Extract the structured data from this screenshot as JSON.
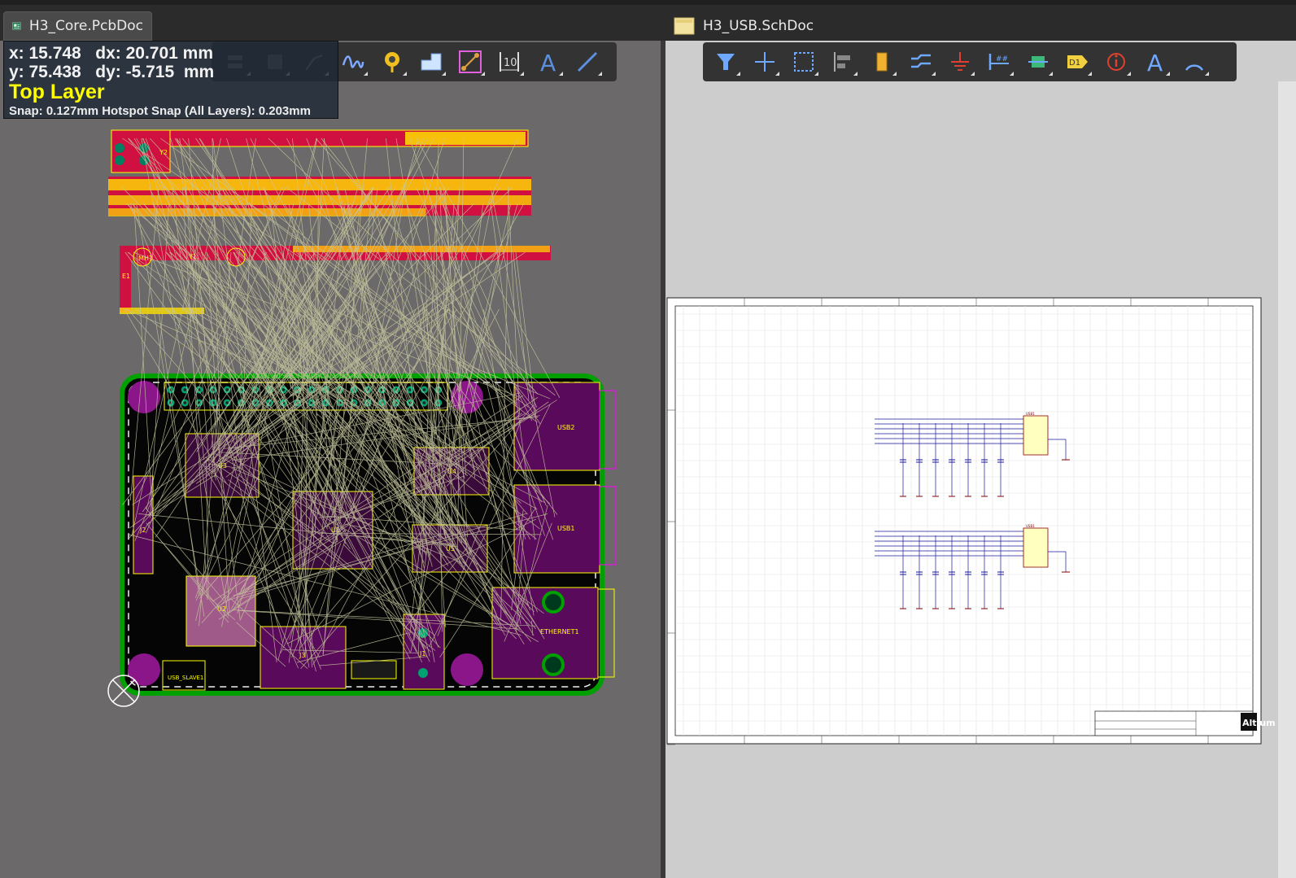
{
  "tabs": [
    {
      "label": "H3_Core.PcbDoc",
      "icon": "pcb-document-icon"
    },
    {
      "label": "H3_USB.SchDoc",
      "icon": "schematic-document-icon"
    }
  ],
  "hud": {
    "x_label": "x: 15.748",
    "dx_label": "dx: 20.701 mm",
    "y_label": "y: 75.438",
    "dy_label": "dy: -5.715  mm",
    "layer": "Top Layer",
    "snap": "Snap: 0.127mm Hotspot Snap (All Layers): 0.203mm"
  },
  "pcb_toolbar": [
    "route-icon",
    "component-icon",
    "net-icon",
    "interactive-length-tuning-icon",
    "place-via-icon",
    "place-polygon-icon",
    "place-line-icon",
    "dimension-icon",
    "text-icon",
    "place-track-icon"
  ],
  "sch_toolbar": [
    "filter-icon",
    "move-icon",
    "select-area-icon",
    "align-icon",
    "place-part-icon",
    "place-bus-icon",
    "ground-icon",
    "net-label-icon",
    "harness-icon",
    "port-icon",
    "directive-icon",
    "text-icon",
    "arc-icon"
  ],
  "pcb_labels": {
    "usb2": "USB2",
    "usb1": "USB1",
    "ethernet": "ETHERNET1",
    "u1": "U1",
    "u2": "U2",
    "u3": "U3",
    "u4": "U4",
    "u5": "U5",
    "j1": "J1",
    "j2": "J2",
    "j3": "J3",
    "usb_slave": "USB_SLAVE1",
    "e1": "E1",
    "mh1": "MH1",
    "y1": "Y1",
    "y2": "Y2"
  },
  "sch": {
    "part1": "USB1",
    "part2": "USB1",
    "title_block": "Altium"
  },
  "colors": {
    "pcb_bg": "#6b6969",
    "board": "#000000",
    "outline": "#00a000",
    "pad": "#ff00ff",
    "silk": "#ffff00",
    "ratsnest": "#c8c8a0"
  }
}
